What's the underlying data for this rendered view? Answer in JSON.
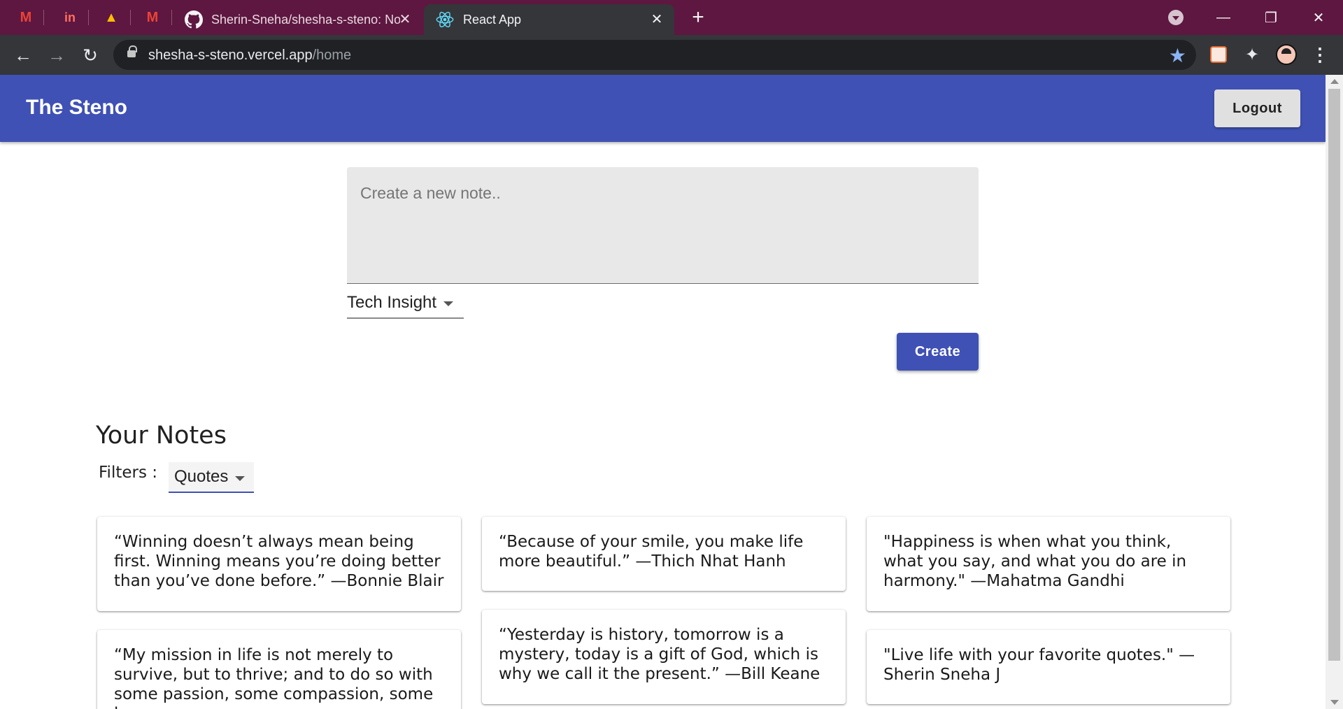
{
  "browser": {
    "pinned_tabs": [
      {
        "name": "gmail-icon",
        "glyph": "M",
        "color": "#ea4335"
      },
      {
        "name": "invision-icon",
        "glyph": "in",
        "color": "#ff6f61"
      },
      {
        "name": "google-drive-icon",
        "glyph": "▲",
        "color": "#fbbc04"
      },
      {
        "name": "gmail-icon",
        "glyph": "M",
        "color": "#ea4335"
      }
    ],
    "tabs": [
      {
        "title": "Sherin-Sneha/shesha-s-steno: No",
        "close": "✕"
      },
      {
        "title": "React App",
        "close": "✕"
      }
    ],
    "new_tab": "+",
    "window": {
      "minimize": "—",
      "restore": "❐",
      "close": "✕"
    },
    "nav": {
      "back": "←",
      "forward": "→",
      "reload": "↻"
    },
    "address": {
      "host": "shesha-s-steno.vercel.app",
      "path": "/home"
    },
    "bookmark_star": "★",
    "extensions_glyph": "✦",
    "menu_glyph": "⋮"
  },
  "app": {
    "brand": "The Steno",
    "logout_label": "Logout",
    "note_placeholder": "Create a new note..",
    "category_value": "Tech Insight",
    "create_label": "Create",
    "notes_heading": "Your Notes",
    "filters_label": "Filters :",
    "filter_value": "Quotes"
  },
  "notes": [
    "“Winning doesn’t always mean being first. Winning means you’re doing better than you’ve done before.” —Bonnie Blair",
    "“Because of your smile, you make life more beautiful.” —Thich Nhat Hanh",
    "\"Happiness is when what you think, what you say, and what you do are in harmony.\" —Mahatma Gandhi",
    "“My mission in life is not merely to survive, but to thrive; and to do so with some passion, some compassion, some humor,",
    "“Yesterday is history, tomorrow is a mystery, today is a gift of God, which is why we call it the present.” —Bill Keane",
    "\"Live life with your favorite quotes.\" —Sherin Sneha J"
  ],
  "colors": {
    "titlebar": "#5e1740",
    "toolbar": "#35363a",
    "appbar": "#3f51b5",
    "primary_button": "#3f51b5"
  }
}
